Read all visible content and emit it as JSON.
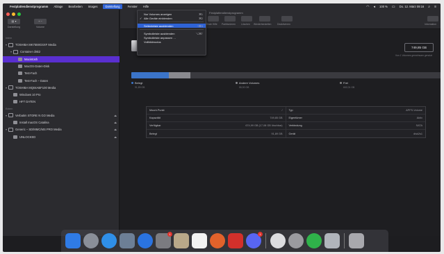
{
  "menubar": {
    "apple": "",
    "app_name": "Festplattendienstprogramm",
    "menus": [
      "Ablage",
      "Bearbeiten",
      "Images",
      "Darstellung",
      "Fenster",
      "Hilfe"
    ],
    "active_menu": "Darstellung",
    "status": [
      "100 %",
      "Do. 12. März 09:16"
    ]
  },
  "window": {
    "title": "Festplattendienstprogramm"
  },
  "toolbar_left": [
    {
      "label": "Darstellung",
      "glyph": "▤ ▾"
    },
    {
      "label": "Volume",
      "glyph": "+ −"
    }
  ],
  "toolbar_main": [
    "Erste Hilfe",
    "Partitionieren",
    "Löschen",
    "Wiederherstellen",
    "Deaktivieren",
    "Information"
  ],
  "view_menu": [
    {
      "label": "Nur Volumes anzeigen",
      "shortcut": "⌘1",
      "checked": false
    },
    {
      "label": "Alle Geräte einblenden",
      "shortcut": "⌘2",
      "checked": true
    },
    {
      "sep": true
    },
    {
      "label": "Seitenleiste ausblenden",
      "shortcut": "^⌘S",
      "checked": false,
      "highlight": true
    },
    {
      "sep": true
    },
    {
      "label": "Symbolleiste ausblenden",
      "shortcut": "⌥⌘T",
      "checked": false
    },
    {
      "label": "Symbolleiste anpassen …",
      "shortcut": "",
      "checked": false
    },
    {
      "label": "Vollbildmodus",
      "shortcut": "",
      "checked": false
    }
  ],
  "sidebar": {
    "internal_header": "Intern",
    "internal_items": [
      {
        "label": "TOSHIBA MK7559GSXF Media",
        "level": 0,
        "type": "disk",
        "chev": "▾"
      },
      {
        "label": "Container disk2",
        "level": 1,
        "type": "disk",
        "chev": "▾"
      },
      {
        "label": "Macintosh",
        "level": 2,
        "type": "volume",
        "chev": "",
        "selected": true
      },
      {
        "label": "MacOS-Daten-Disk",
        "level": 2,
        "type": "volume",
        "chev": ""
      },
      {
        "label": "Test-Fach",
        "level": 2,
        "type": "volume",
        "chev": ""
      },
      {
        "label": "Test-Fach – Daten",
        "level": 2,
        "type": "volume",
        "chev": ""
      },
      {
        "label": "TOSHIBA MQ04ABF100 Media",
        "level": 0,
        "type": "disk",
        "chev": "▾"
      },
      {
        "label": "Windows 10 Pro",
        "level": 1,
        "type": "volume",
        "chev": ""
      },
      {
        "label": "HFT DATEN",
        "level": 1,
        "type": "volume",
        "chev": ""
      }
    ],
    "external_header": "Extern",
    "external_items": [
      {
        "label": "Verbatim STORE N GO Media",
        "level": 0,
        "type": "disk",
        "chev": "▾",
        "eject": "⏏"
      },
      {
        "label": "Install macOS Catalina",
        "level": 1,
        "type": "volume",
        "chev": "",
        "eject": "⏏"
      },
      {
        "label": "Generic – SD/MMC/MS PRO Media",
        "level": 0,
        "type": "disk",
        "chev": "▾",
        "eject": "⏏"
      },
      {
        "label": "UNLOCKED",
        "level": 1,
        "type": "volume",
        "chev": "",
        "eject": "⏏"
      }
    ]
  },
  "volume": {
    "badge": "749,85 GB",
    "badge_sub": "Von 1 Volumes gemeinsam genutzt"
  },
  "usage": {
    "used_fraction": 0.12,
    "other_fraction": 0.07,
    "legend": [
      {
        "label": "Belegt",
        "size": "91,89 GB",
        "color": "#3b74c8"
      },
      {
        "label": "Andere Volumes",
        "size": "55,92 GB",
        "color": "#8a8a8f"
      },
      {
        "label": "Frei",
        "size": "602,01 GB",
        "color": "#5a5a60"
      }
    ]
  },
  "info_table": [
    [
      {
        "k": "Mount-Punkt",
        "v": "/"
      },
      {
        "k": "Typ",
        "v": "APFS-Volume"
      }
    ],
    [
      {
        "k": "Kapazität",
        "v": "749,85 GB"
      },
      {
        "k": "Eigentümer",
        "v": "Aktiv"
      }
    ],
    [
      {
        "k": "Verfügbar",
        "v": "674,99 GB (17,08 GB löschbar)"
      },
      {
        "k": "Verbindung",
        "v": "SATA"
      }
    ],
    [
      {
        "k": "Belegt",
        "v": "91,89 GB"
      },
      {
        "k": "Gerät",
        "v": "disk2s1"
      }
    ]
  ],
  "dock": [
    {
      "name": "finder-icon",
      "color": "#2f7be6"
    },
    {
      "name": "launchpad-icon",
      "color": "#8a8f99",
      "round": true
    },
    {
      "name": "safari-icon",
      "color": "#2f8fe8",
      "round": true
    },
    {
      "name": "photo-booth-icon",
      "color": "#6d7f96"
    },
    {
      "name": "app-store-icon",
      "color": "#2a73e0",
      "round": true
    },
    {
      "name": "system-preferences-icon",
      "color": "#7b7b80",
      "badge": "1"
    },
    {
      "name": "disk-utility-icon",
      "color": "#b9a889"
    },
    {
      "name": "textedit-icon",
      "color": "#f3f3f3"
    },
    {
      "name": "firefox-icon",
      "color": "#e2622b",
      "round": true
    },
    {
      "name": "arrow-app-icon",
      "color": "#d2302b"
    },
    {
      "name": "discord-icon",
      "color": "#5865f2",
      "round": true,
      "badge": "1"
    },
    {
      "sep": true
    },
    {
      "name": "messages-icon",
      "color": "#dcdcdf",
      "round": true
    },
    {
      "name": "dvd-player-icon",
      "color": "#9a9a9f",
      "round": true
    },
    {
      "name": "green-app-icon",
      "color": "#2fb24a",
      "round": true
    },
    {
      "name": "downloads-icon",
      "color": "#b0b4bb"
    },
    {
      "sep": true
    },
    {
      "name": "trash-icon",
      "color": "#a8a8ad"
    }
  ]
}
